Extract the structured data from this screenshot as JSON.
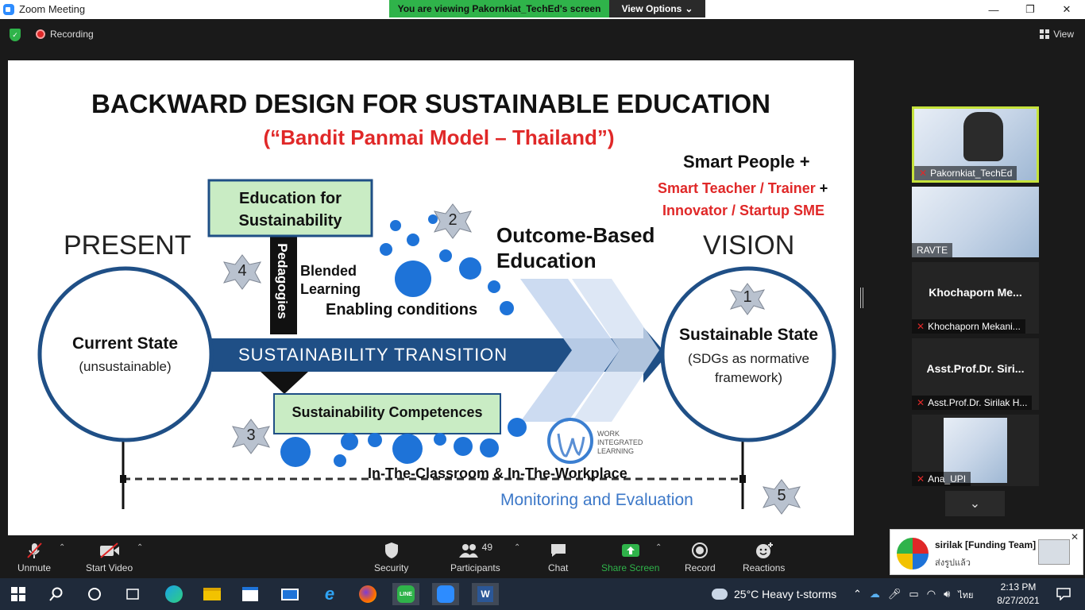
{
  "window": {
    "title": "Zoom Meeting",
    "banner": "You are viewing Pakornkiat_TechEd's screen",
    "view_options": "View Options"
  },
  "topbar": {
    "recording": "Recording",
    "view": "View"
  },
  "slide": {
    "title": "BACKWARD DESIGN FOR SUSTAINABLE EDUCATION",
    "subtitle": "(“Bandit Panmai Model – Thailand”)",
    "smart_people": "Smart People +",
    "smart_teacher": "Smart Teacher / Trainer",
    "plus": "+",
    "innovator": "Innovator / Startup SME",
    "present": "PRESENT",
    "vision": "VISION",
    "current_state": "Current State",
    "unsustainable": "(unsustainable)",
    "edu_sust_1": "Education for",
    "edu_sust_2": "Sustainability",
    "pedagogies": "Pedagogies",
    "blended_1": "Blended",
    "blended_2": "Learning",
    "enabling": "Enabling conditions",
    "obe_1": "Outcome-Based",
    "obe_2": "Education",
    "transition": "SUSTAINABILITY  TRANSITION",
    "sust_state": "Sustainable State",
    "sdg_1": "(SDGs as normative",
    "sdg_2": "framework)",
    "competences": "Sustainability  Competences",
    "classroom": "In-The-Classroom & In-The-Workplace",
    "monitoring": "Monitoring and Evaluation",
    "wil_1": "WORK",
    "wil_2": "INTEGRATED",
    "wil_3": "LEARNING",
    "stars": [
      "1",
      "2",
      "3",
      "4",
      "5"
    ]
  },
  "participants": [
    {
      "name": "Pakornkiat_TechEd"
    },
    {
      "name": "RAVTE"
    },
    {
      "big": "Khochaporn  Me...",
      "name": "Khochaporn Mekani..."
    },
    {
      "big": "Asst.Prof.Dr.  Siri...",
      "name": "Asst.Prof.Dr. Sirilak H..."
    },
    {
      "name": "Ana_UPI"
    }
  ],
  "toolbar": {
    "unmute": "Unmute",
    "start_video": "Start Video",
    "security": "Security",
    "participants": "Participants",
    "participants_count": "49",
    "chat": "Chat",
    "share_screen": "Share Screen",
    "record": "Record",
    "reactions": "Reactions"
  },
  "notification": {
    "name": "sirilak [Funding Team]",
    "message": "ส่งรูปแล้ว"
  },
  "taskbar": {
    "weather": "25°C  Heavy t-storms",
    "lang": "ไทย",
    "time": "2:13 PM",
    "date": "8/27/2021"
  },
  "colors": {
    "zoom_green": "#2fb34a",
    "accent_red": "#e02828",
    "arrow_blue": "#1f4f86",
    "dot_blue": "#1e73d8",
    "box_green": "#c9ecc4"
  }
}
